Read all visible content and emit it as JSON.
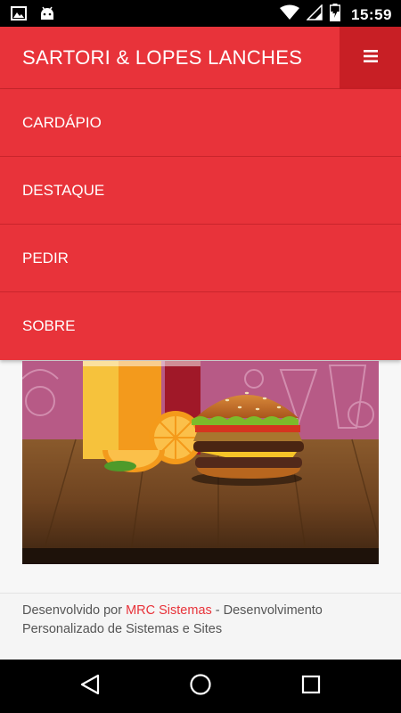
{
  "status_bar": {
    "time": "15:59",
    "left_icons": [
      "image-icon",
      "android-icon"
    ],
    "right_icons": [
      "wifi-icon",
      "cell-signal-icon",
      "battery-charging-icon"
    ]
  },
  "app_bar": {
    "title": "SARTORI & LOPES LANCHES",
    "menu_icon": "hamburger-menu-icon",
    "background_color": "#e8333a",
    "menu_button_color": "#c81f25"
  },
  "menu": {
    "items": [
      {
        "label": "CARDÁPIO"
      },
      {
        "label": "DESTAQUE"
      },
      {
        "label": "PEDIR"
      },
      {
        "label": "SOBRE"
      }
    ]
  },
  "footer": {
    "prefix": "Desenvolvido por ",
    "link_text": "MRC Sistemas",
    "suffix": " - Desenvolvimento Personalizado de Sistemas e Sites",
    "link_color": "#e8333a"
  },
  "nav_bar": {
    "icons": [
      "back-icon",
      "home-icon",
      "recents-icon"
    ]
  }
}
